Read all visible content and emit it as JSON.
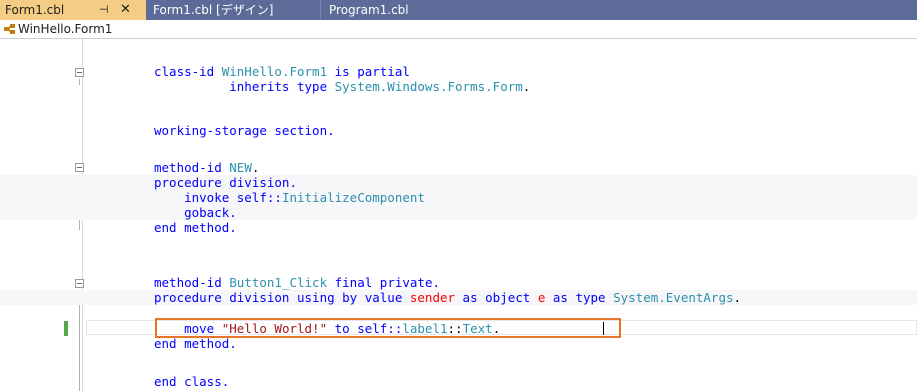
{
  "tabs": [
    {
      "label": "Form1.cbl",
      "pin": "⊣",
      "close": "✕",
      "active": true
    },
    {
      "label": "Form1.cbl [デザイン]",
      "active": false
    },
    {
      "label": "Program1.cbl",
      "active": false
    }
  ],
  "navbar": {
    "label": "WinHello.Form1",
    "icon": "class-icon"
  },
  "code": {
    "l1": {
      "a": "class-id ",
      "b": "WinHello.Form1",
      "c": " is partial"
    },
    "l2": {
      "a": "          inherits type ",
      "b": "System.Windows.Forms.Form",
      "c": "."
    },
    "l4": {
      "a": "working-storage section."
    },
    "l6": {
      "a": "method-id ",
      "b": "NEW",
      "c": "."
    },
    "l7": {
      "a": "procedure division."
    },
    "l8": {
      "a": "    invoke self::",
      "b": "InitializeComponent"
    },
    "l9": {
      "a": "    goback."
    },
    "l10": {
      "a": "end method."
    },
    "l12": {
      "a": "method-id ",
      "b": "Button1_Click",
      "c": " final private."
    },
    "l13": {
      "a": "procedure division using by value ",
      "b": "sender",
      "c": " as object ",
      "d": "e",
      "e": " as type ",
      "f": "System.EventArgs",
      "g": "."
    },
    "l14": {
      "a": "    move ",
      "b": "\"Hello World!\"",
      "c": " to self::",
      "d": "label1",
      "e": "::",
      "f": "Text",
      "g": "."
    },
    "l15": {
      "a": "end method."
    },
    "l17": {
      "a": "end class."
    }
  },
  "colors": {
    "tab_active": "#f5cc84",
    "tabbar": "#5d6b99",
    "highlight_border": "#e8742c",
    "keyword": "#0000ff",
    "string": "#a31515"
  }
}
